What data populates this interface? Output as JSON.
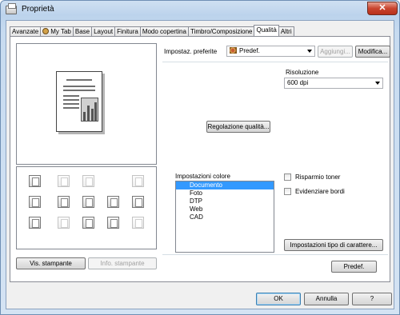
{
  "window": {
    "title": "Proprietà",
    "close_glyph": "✕"
  },
  "tabs": [
    "Avanzate",
    "My Tab",
    "Base",
    "Layout",
    "Finitura",
    "Modo copertina",
    "Timbro/Composizione",
    "Qualità",
    "Altri"
  ],
  "active_tab": "Qualità",
  "left_panel": {
    "printer_view_button": "Vis. stampante",
    "printer_info_button": "Info. stampante"
  },
  "favorites": {
    "label": "Impostaz. preferite",
    "selected": "Predef.",
    "add_button": "Aggiungi...",
    "edit_button": "Modifica..."
  },
  "quality_button": "Regolazione qualità...",
  "resolution": {
    "label": "Risoluzione",
    "value": "600 dpi"
  },
  "color_settings": {
    "label": "Impostazioni colore",
    "options": [
      "Documento",
      "Foto",
      "DTP",
      "Web",
      "CAD"
    ],
    "selected": "Documento"
  },
  "toner_save": {
    "label": "Risparmio toner",
    "checked": false
  },
  "edge_enhance": {
    "label": "Evidenziare bordi",
    "checked": false
  },
  "font_settings_button": "Impostazioni tipo di carattere...",
  "default_button": "Predef.",
  "dialog_buttons": {
    "ok": "OK",
    "cancel": "Annulla",
    "help": "?"
  }
}
